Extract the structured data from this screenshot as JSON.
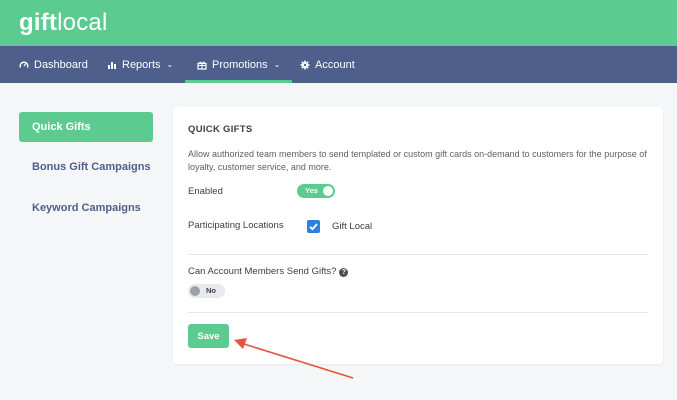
{
  "brand": {
    "logo_bold": "gift",
    "logo_light": "local",
    "color_primary": "#5ccb90",
    "color_nav": "#4d5f8a"
  },
  "nav": {
    "items": [
      {
        "label": "Dashboard",
        "icon": "gauge-icon",
        "has_dropdown": false
      },
      {
        "label": "Reports",
        "icon": "bar-chart-icon",
        "has_dropdown": true
      },
      {
        "label": "Promotions",
        "icon": "gift-icon",
        "has_dropdown": true,
        "active": true
      },
      {
        "label": "Account",
        "icon": "gear-icon",
        "has_dropdown": false
      }
    ]
  },
  "sidebar": {
    "items": [
      {
        "label": "Quick Gifts",
        "active": true
      },
      {
        "label": "Bonus Gift Campaigns"
      },
      {
        "label": "Keyword Campaigns"
      }
    ]
  },
  "card": {
    "title": "QUICK GIFTS",
    "description": "Allow authorized team members to send templated or custom gift cards on-demand to customers for the purpose of loyalty, customer service, and more.",
    "enabled_label": "Enabled",
    "enabled_toggle": "Yes",
    "locations_label": "Participating Locations",
    "location_option": "Gift Local",
    "members_label": "Can Account Members Send Gifts?",
    "members_help_icon": "help-circle-icon",
    "members_toggle": "No",
    "save_label": "Save"
  },
  "annotation": {
    "arrow_color": "#e8543c"
  }
}
